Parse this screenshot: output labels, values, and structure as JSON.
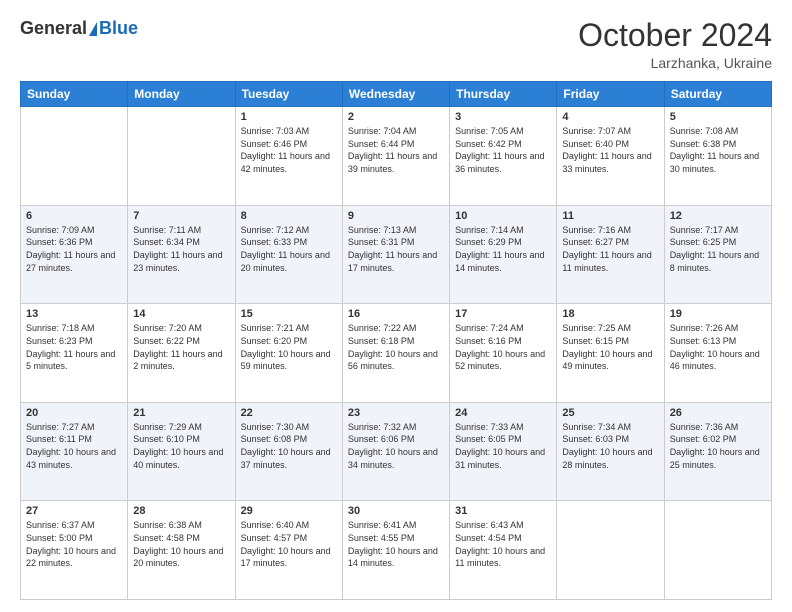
{
  "header": {
    "logo_general": "General",
    "logo_blue": "Blue",
    "month": "October 2024",
    "location": "Larzhanka, Ukraine"
  },
  "days_of_week": [
    "Sunday",
    "Monday",
    "Tuesday",
    "Wednesday",
    "Thursday",
    "Friday",
    "Saturday"
  ],
  "weeks": [
    [
      {
        "day": "",
        "sunrise": "",
        "sunset": "",
        "daylight": ""
      },
      {
        "day": "",
        "sunrise": "",
        "sunset": "",
        "daylight": ""
      },
      {
        "day": "1",
        "sunrise": "Sunrise: 7:03 AM",
        "sunset": "Sunset: 6:46 PM",
        "daylight": "Daylight: 11 hours and 42 minutes."
      },
      {
        "day": "2",
        "sunrise": "Sunrise: 7:04 AM",
        "sunset": "Sunset: 6:44 PM",
        "daylight": "Daylight: 11 hours and 39 minutes."
      },
      {
        "day": "3",
        "sunrise": "Sunrise: 7:05 AM",
        "sunset": "Sunset: 6:42 PM",
        "daylight": "Daylight: 11 hours and 36 minutes."
      },
      {
        "day": "4",
        "sunrise": "Sunrise: 7:07 AM",
        "sunset": "Sunset: 6:40 PM",
        "daylight": "Daylight: 11 hours and 33 minutes."
      },
      {
        "day": "5",
        "sunrise": "Sunrise: 7:08 AM",
        "sunset": "Sunset: 6:38 PM",
        "daylight": "Daylight: 11 hours and 30 minutes."
      }
    ],
    [
      {
        "day": "6",
        "sunrise": "Sunrise: 7:09 AM",
        "sunset": "Sunset: 6:36 PM",
        "daylight": "Daylight: 11 hours and 27 minutes."
      },
      {
        "day": "7",
        "sunrise": "Sunrise: 7:11 AM",
        "sunset": "Sunset: 6:34 PM",
        "daylight": "Daylight: 11 hours and 23 minutes."
      },
      {
        "day": "8",
        "sunrise": "Sunrise: 7:12 AM",
        "sunset": "Sunset: 6:33 PM",
        "daylight": "Daylight: 11 hours and 20 minutes."
      },
      {
        "day": "9",
        "sunrise": "Sunrise: 7:13 AM",
        "sunset": "Sunset: 6:31 PM",
        "daylight": "Daylight: 11 hours and 17 minutes."
      },
      {
        "day": "10",
        "sunrise": "Sunrise: 7:14 AM",
        "sunset": "Sunset: 6:29 PM",
        "daylight": "Daylight: 11 hours and 14 minutes."
      },
      {
        "day": "11",
        "sunrise": "Sunrise: 7:16 AM",
        "sunset": "Sunset: 6:27 PM",
        "daylight": "Daylight: 11 hours and 11 minutes."
      },
      {
        "day": "12",
        "sunrise": "Sunrise: 7:17 AM",
        "sunset": "Sunset: 6:25 PM",
        "daylight": "Daylight: 11 hours and 8 minutes."
      }
    ],
    [
      {
        "day": "13",
        "sunrise": "Sunrise: 7:18 AM",
        "sunset": "Sunset: 6:23 PM",
        "daylight": "Daylight: 11 hours and 5 minutes."
      },
      {
        "day": "14",
        "sunrise": "Sunrise: 7:20 AM",
        "sunset": "Sunset: 6:22 PM",
        "daylight": "Daylight: 11 hours and 2 minutes."
      },
      {
        "day": "15",
        "sunrise": "Sunrise: 7:21 AM",
        "sunset": "Sunset: 6:20 PM",
        "daylight": "Daylight: 10 hours and 59 minutes."
      },
      {
        "day": "16",
        "sunrise": "Sunrise: 7:22 AM",
        "sunset": "Sunset: 6:18 PM",
        "daylight": "Daylight: 10 hours and 56 minutes."
      },
      {
        "day": "17",
        "sunrise": "Sunrise: 7:24 AM",
        "sunset": "Sunset: 6:16 PM",
        "daylight": "Daylight: 10 hours and 52 minutes."
      },
      {
        "day": "18",
        "sunrise": "Sunrise: 7:25 AM",
        "sunset": "Sunset: 6:15 PM",
        "daylight": "Daylight: 10 hours and 49 minutes."
      },
      {
        "day": "19",
        "sunrise": "Sunrise: 7:26 AM",
        "sunset": "Sunset: 6:13 PM",
        "daylight": "Daylight: 10 hours and 46 minutes."
      }
    ],
    [
      {
        "day": "20",
        "sunrise": "Sunrise: 7:27 AM",
        "sunset": "Sunset: 6:11 PM",
        "daylight": "Daylight: 10 hours and 43 minutes."
      },
      {
        "day": "21",
        "sunrise": "Sunrise: 7:29 AM",
        "sunset": "Sunset: 6:10 PM",
        "daylight": "Daylight: 10 hours and 40 minutes."
      },
      {
        "day": "22",
        "sunrise": "Sunrise: 7:30 AM",
        "sunset": "Sunset: 6:08 PM",
        "daylight": "Daylight: 10 hours and 37 minutes."
      },
      {
        "day": "23",
        "sunrise": "Sunrise: 7:32 AM",
        "sunset": "Sunset: 6:06 PM",
        "daylight": "Daylight: 10 hours and 34 minutes."
      },
      {
        "day": "24",
        "sunrise": "Sunrise: 7:33 AM",
        "sunset": "Sunset: 6:05 PM",
        "daylight": "Daylight: 10 hours and 31 minutes."
      },
      {
        "day": "25",
        "sunrise": "Sunrise: 7:34 AM",
        "sunset": "Sunset: 6:03 PM",
        "daylight": "Daylight: 10 hours and 28 minutes."
      },
      {
        "day": "26",
        "sunrise": "Sunrise: 7:36 AM",
        "sunset": "Sunset: 6:02 PM",
        "daylight": "Daylight: 10 hours and 25 minutes."
      }
    ],
    [
      {
        "day": "27",
        "sunrise": "Sunrise: 6:37 AM",
        "sunset": "Sunset: 5:00 PM",
        "daylight": "Daylight: 10 hours and 22 minutes."
      },
      {
        "day": "28",
        "sunrise": "Sunrise: 6:38 AM",
        "sunset": "Sunset: 4:58 PM",
        "daylight": "Daylight: 10 hours and 20 minutes."
      },
      {
        "day": "29",
        "sunrise": "Sunrise: 6:40 AM",
        "sunset": "Sunset: 4:57 PM",
        "daylight": "Daylight: 10 hours and 17 minutes."
      },
      {
        "day": "30",
        "sunrise": "Sunrise: 6:41 AM",
        "sunset": "Sunset: 4:55 PM",
        "daylight": "Daylight: 10 hours and 14 minutes."
      },
      {
        "day": "31",
        "sunrise": "Sunrise: 6:43 AM",
        "sunset": "Sunset: 4:54 PM",
        "daylight": "Daylight: 10 hours and 11 minutes."
      },
      {
        "day": "",
        "sunrise": "",
        "sunset": "",
        "daylight": ""
      },
      {
        "day": "",
        "sunrise": "",
        "sunset": "",
        "daylight": ""
      }
    ]
  ]
}
